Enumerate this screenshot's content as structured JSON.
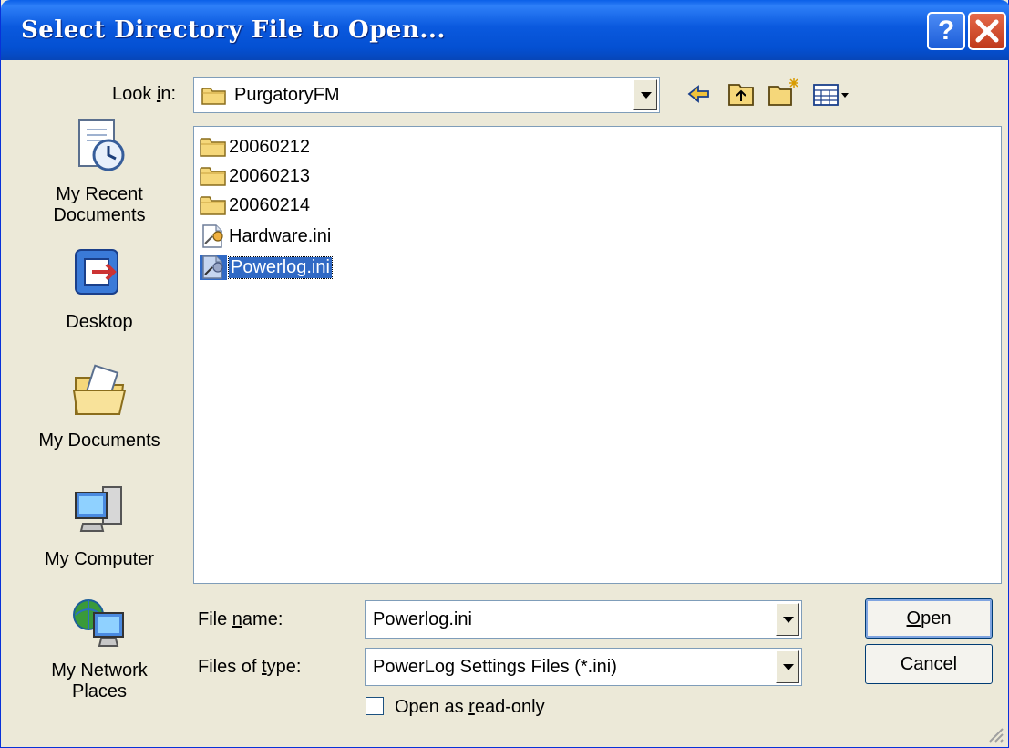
{
  "window": {
    "title": "Select Directory File to Open..."
  },
  "look_in": {
    "label_pre": "Look ",
    "label_key": "i",
    "label_post": "n:",
    "value": "PurgatoryFM"
  },
  "places": [
    {
      "line1": "My Recent",
      "line2": "Documents",
      "icon": "recent-documents-icon"
    },
    {
      "line1": "Desktop",
      "line2": "",
      "icon": "desktop-icon"
    },
    {
      "line1": "My Documents",
      "line2": "",
      "icon": "my-documents-icon"
    },
    {
      "line1": "My Computer",
      "line2": "",
      "icon": "my-computer-icon"
    },
    {
      "line1": "My Network",
      "line2": "Places",
      "icon": "network-places-icon"
    }
  ],
  "files": [
    {
      "name": "20060212",
      "type": "folder"
    },
    {
      "name": "20060213",
      "type": "folder"
    },
    {
      "name": "20060214",
      "type": "folder"
    },
    {
      "name": "Hardware.ini",
      "type": "ini"
    },
    {
      "name": "Powerlog.ini",
      "type": "ini",
      "selected": true
    }
  ],
  "file_name": {
    "label_pre": "File ",
    "label_key": "n",
    "label_post": "ame:",
    "value": "Powerlog.ini"
  },
  "file_type": {
    "label_pre": "Files of ",
    "label_key": "t",
    "label_post": "ype:",
    "value": "PowerLog Settings Files (*.ini)"
  },
  "read_only": {
    "label_pre": "Open as ",
    "label_key": "r",
    "label_post": "ead-only",
    "checked": false
  },
  "buttons": {
    "open_key": "O",
    "open_rest": "pen",
    "cancel": "Cancel"
  },
  "toolbar": {
    "back": "back-icon",
    "up": "up-folder-icon",
    "new_folder": "new-folder-icon",
    "views": "views-menu-icon"
  },
  "colors": {
    "titlebar": "#0a59de",
    "selection": "#316ac5",
    "dialog_bg": "#ece9d8"
  }
}
